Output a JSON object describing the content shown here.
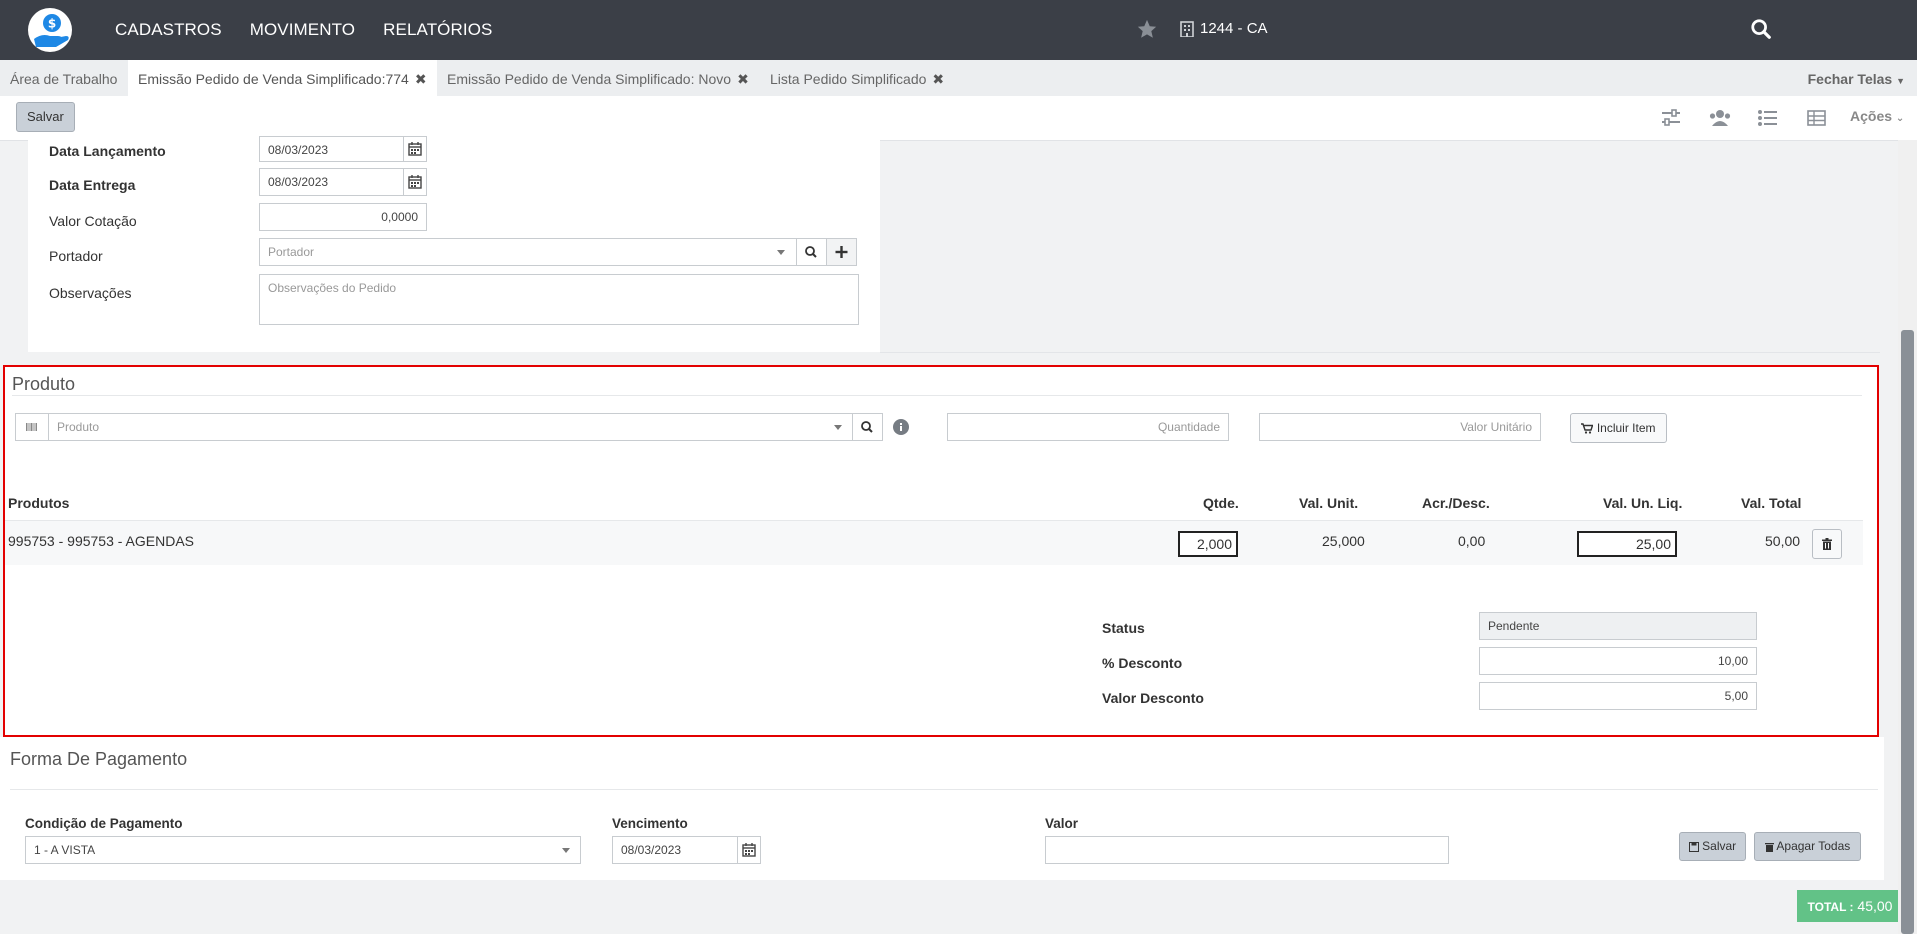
{
  "nav": {
    "menu": [
      "CADASTROS",
      "MOVIMENTO",
      "RELATÓRIOS"
    ],
    "company": "1244 - CA"
  },
  "tabs": {
    "items": [
      {
        "label": "Área de Trabalho"
      },
      {
        "label": "Emissão Pedido de Venda Simplificado:774"
      },
      {
        "label": "Emissão Pedido de Venda Simplificado: Novo"
      },
      {
        "label": "Lista Pedido Simplificado"
      }
    ],
    "close_all": "Fechar Telas"
  },
  "toolbar": {
    "save_label": "Salvar",
    "actions_label": "Ações"
  },
  "header_form": {
    "data_lancamento": {
      "label": "Data Lançamento",
      "value": "08/03/2023"
    },
    "data_entrega": {
      "label": "Data Entrega",
      "value": "08/03/2023"
    },
    "valor_cotacao": {
      "label": "Valor Cotação",
      "value": "0,0000"
    },
    "portador": {
      "label": "Portador",
      "placeholder": "Portador"
    },
    "observacoes": {
      "label": "Observações",
      "placeholder": "Observações do Pedido"
    }
  },
  "produto": {
    "title": "Produto",
    "product_placeholder": "Produto",
    "quantidade_placeholder": "Quantidade",
    "valor_unitario_placeholder": "Valor Unitário",
    "incluir_label": "Incluir Item",
    "columns": {
      "produtos": "Produtos",
      "qtde": "Qtde.",
      "val_unit": "Val. Unit.",
      "acr_desc": "Acr./Desc.",
      "val_un_liq": "Val. Un. Liq.",
      "val_total": "Val. Total"
    },
    "rows": [
      {
        "produto": "995753 - 995753 - AGENDAS",
        "qtde": "2,000",
        "val_unit": "25,000",
        "acr_desc": "0,00",
        "val_un_liq": "25,00",
        "val_total": "50,00"
      }
    ],
    "summary": {
      "status_label": "Status",
      "status_value": "Pendente",
      "desconto_pct_label": "% Desconto",
      "desconto_pct_value": "10,00",
      "valor_desconto_label": "Valor Desconto",
      "valor_desconto_value": "5,00"
    }
  },
  "pagamento": {
    "title": "Forma De Pagamento",
    "condicao_label": "Condição de Pagamento",
    "condicao_value": "1 - A VISTA",
    "vencimento_label": "Vencimento",
    "vencimento_value": "08/03/2023",
    "valor_label": "Valor",
    "salvar_label": "Salvar",
    "apagar_label": "Apagar Todas"
  },
  "total": {
    "label": "TOTAL :",
    "value": "45,00"
  },
  "colors": {
    "navbar": "#3b3f47",
    "highlight_border": "#e30000",
    "total_badge": "#62c287",
    "logo": "#1e88e5"
  }
}
